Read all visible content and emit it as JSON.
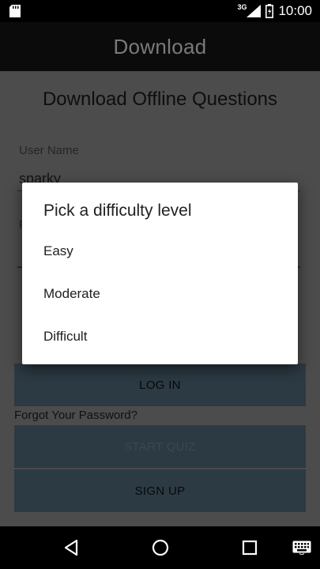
{
  "status_bar": {
    "network": "3G",
    "time": "10:00",
    "icons": [
      "sd-card-icon",
      "signal-icon",
      "battery-icon"
    ]
  },
  "action_bar": {
    "title": "Download"
  },
  "screen": {
    "heading": "Download Offline Questions",
    "username_label": "User Name",
    "username_value": "sparky",
    "password_label_visible": "P",
    "login_button": "LOG IN",
    "forgot_password": "Forgot Your Password?",
    "start_quiz_button": "START QUIZ",
    "signup_button": "SIGN UP"
  },
  "dialog": {
    "title": "Pick a difficulty level",
    "options": [
      "Easy",
      "Moderate",
      "Difficult"
    ]
  },
  "colors": {
    "scrim": "#4c4c4c",
    "button": "#2c3a44",
    "dialog_bg": "#ffffff",
    "accent_underline": "#0d3a30"
  },
  "nav_bar": {
    "icons": [
      "back-icon",
      "home-icon",
      "recents-icon",
      "keyboard-icon"
    ]
  }
}
